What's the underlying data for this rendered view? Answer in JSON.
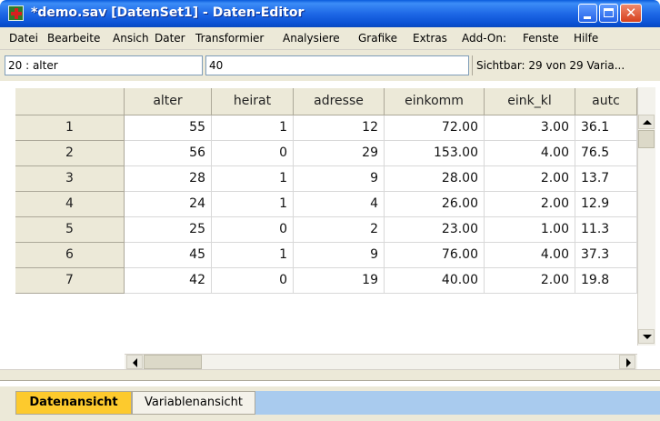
{
  "window": {
    "title": "*demo.sav [DatenSet1] - Daten-Editor",
    "colors": {
      "titlebar": "#0a5bdc",
      "active_tab": "#fdca2d",
      "tab_strip": "#a9cbee"
    }
  },
  "menu": [
    {
      "label": "Datei",
      "mnemonic": "t"
    },
    {
      "label": "Bearbeite",
      "mnemonic": "B"
    },
    {
      "label": "Ansich",
      "mnemonic": "A"
    },
    {
      "label": "Dater",
      "mnemonic": "t"
    },
    {
      "label": "Transformier",
      "mnemonic": "T"
    },
    {
      "label": "Analysiere",
      "mnemonic": "l"
    },
    {
      "label": "Grafike",
      "mnemonic": "G"
    },
    {
      "label": "Extras",
      "mnemonic": "x"
    },
    {
      "label": "Add-On:",
      "mnemonic": "O"
    },
    {
      "label": "Fenste",
      "mnemonic": "F"
    },
    {
      "label": "Hilfe",
      "mnemonic": "H"
    }
  ],
  "cell_info": {
    "reference": "20 : alter",
    "value": "40",
    "visible": "Sichtbar: 29 von 29 Varia..."
  },
  "grid": {
    "columns": [
      "alter",
      "heirat",
      "adresse",
      "einkomm",
      "eink_kl",
      "autc"
    ],
    "rows": [
      {
        "id": "1",
        "cells": [
          "55",
          "1",
          "12",
          "72.00",
          "3.00",
          "36.1"
        ]
      },
      {
        "id": "2",
        "cells": [
          "56",
          "0",
          "29",
          "153.00",
          "4.00",
          "76.5"
        ]
      },
      {
        "id": "3",
        "cells": [
          "28",
          "1",
          "9",
          "28.00",
          "2.00",
          "13.7"
        ]
      },
      {
        "id": "4",
        "cells": [
          "24",
          "1",
          "4",
          "26.00",
          "2.00",
          "12.9"
        ]
      },
      {
        "id": "5",
        "cells": [
          "25",
          "0",
          "2",
          "23.00",
          "1.00",
          "11.3"
        ]
      },
      {
        "id": "6",
        "cells": [
          "45",
          "1",
          "9",
          "76.00",
          "4.00",
          "37.3"
        ]
      },
      {
        "id": "7",
        "cells": [
          "42",
          "0",
          "19",
          "40.00",
          "2.00",
          "19.8"
        ]
      }
    ]
  },
  "tabs": {
    "data_view": "Datenansicht",
    "variable_view": "Variablenansicht"
  }
}
